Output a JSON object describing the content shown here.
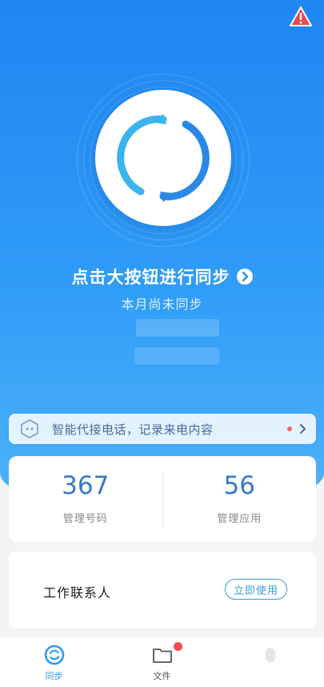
{
  "colors": {
    "primary": "#2f9cf7",
    "accent_text": "#3a78c8",
    "badge": "#f04b4b",
    "alert": "#e84a55"
  },
  "header": {
    "alert_icon": "warning-triangle-icon"
  },
  "sync": {
    "title": "点击大按钮进行同步",
    "subtitle": "本月尚未同步",
    "button_icon": "sync-circle-icon"
  },
  "banner": {
    "text": "智能代接电话，记录来电内容",
    "icon": "robot-icon"
  },
  "stats": [
    {
      "value": "367",
      "label": "管理号码"
    },
    {
      "value": "56",
      "label": "管理应用"
    }
  ],
  "contacts": {
    "label": "工作联系人",
    "button": "立即使用"
  },
  "tabs": [
    {
      "label": "同步",
      "icon": "sync-tab-icon",
      "active": true
    },
    {
      "label": "文件",
      "icon": "folder-icon",
      "active": false,
      "badge": true
    },
    {
      "label": "",
      "icon": "profile-icon",
      "active": false
    }
  ]
}
